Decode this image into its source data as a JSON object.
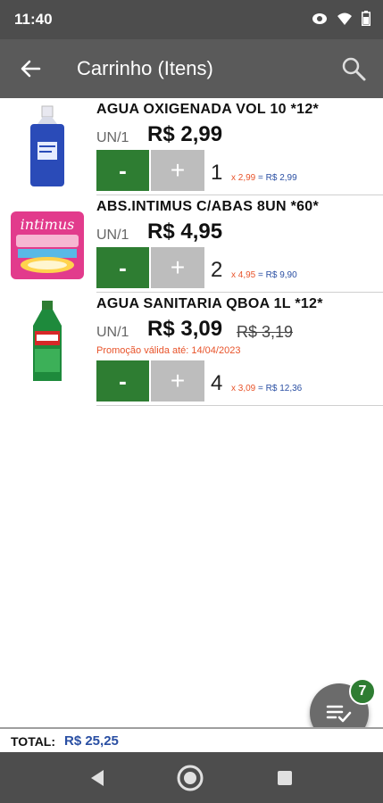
{
  "status_bar": {
    "time": "11:40"
  },
  "app_bar": {
    "title": "Carrinho (Itens)"
  },
  "items": [
    {
      "name": "AGUA OXIGENADA VOL 10 *12*",
      "unit": "UN/1",
      "price": "R$ 2,99",
      "old_price": "",
      "promo": "",
      "minus": "-",
      "plus": "+",
      "qty": "1",
      "calc_mult": "x 2,99",
      "calc_total": "= R$ 2,99"
    },
    {
      "name": "ABS.INTIMUS C/ABAS 8UN *60*",
      "unit": "UN/1",
      "price": "R$ 4,95",
      "old_price": "",
      "promo": "",
      "minus": "-",
      "plus": "+",
      "qty": "2",
      "calc_mult": "x 4,95",
      "calc_total": "= R$ 9,90"
    },
    {
      "name": "AGUA SANITARIA QBOA 1L *12*",
      "unit": "UN/1",
      "price": "R$ 3,09",
      "old_price": "R$ 3,19",
      "promo": "Promoção válida até: 14/04/2023",
      "minus": "-",
      "plus": "+",
      "qty": "4",
      "calc_mult": "x 3,09",
      "calc_total": "= R$ 12,36"
    }
  ],
  "fab": {
    "badge": "7",
    "icon": "playlist-check-icon"
  },
  "footer": {
    "total_label": "TOTAL:",
    "total_value": "R$ 25,25"
  },
  "colors": {
    "accent_green": "#2e7d32",
    "total_blue": "#2a4fa3",
    "promo_orange": "#e8532a",
    "app_bar": "#5a5a5a"
  }
}
